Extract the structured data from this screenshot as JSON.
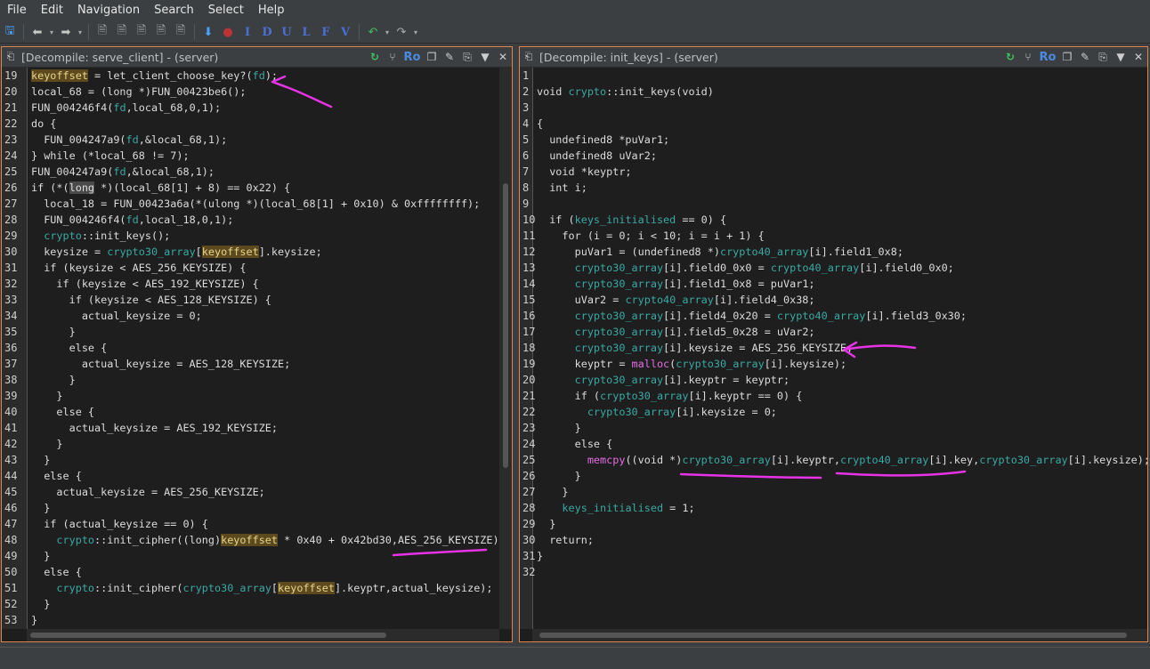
{
  "menu": [
    "File",
    "Edit",
    "Navigation",
    "Search",
    "Select",
    "Help"
  ],
  "toolbar": {
    "letters": [
      "I",
      "D",
      "U",
      "L",
      "F",
      "V"
    ]
  },
  "left_panel": {
    "title": "[Decompile: serve_client] - (server)",
    "ro_label": "Ro",
    "line_numbers": [
      "19",
      "20",
      "21",
      "22",
      "23",
      "24",
      "25",
      "26",
      "27",
      "28",
      "29",
      "30",
      "31",
      "32",
      "33",
      "34",
      "35",
      "36",
      "37",
      "38",
      "39",
      "40",
      "41",
      "42",
      "43",
      "44",
      "45",
      "46",
      "47",
      "48",
      "49",
      "50",
      "51",
      "52",
      "53"
    ]
  },
  "right_panel": {
    "title": "[Decompile: init_keys] - (server)",
    "ro_label": "Ro",
    "line_numbers": [
      "1",
      "2",
      "3",
      "4",
      "5",
      "6",
      "7",
      "8",
      "9",
      "10",
      "11",
      "12",
      "13",
      "14",
      "15",
      "16",
      "17",
      "18",
      "19",
      "20",
      "21",
      "22",
      "23",
      "24",
      "25",
      "26",
      "27",
      "28",
      "29",
      "30",
      "31",
      "32"
    ]
  },
  "colors": {
    "accent_border": "#e1854b",
    "annotation": "#e633e6",
    "highlight_bg": "#5c4a1e",
    "variable": "#3aa9a6"
  }
}
